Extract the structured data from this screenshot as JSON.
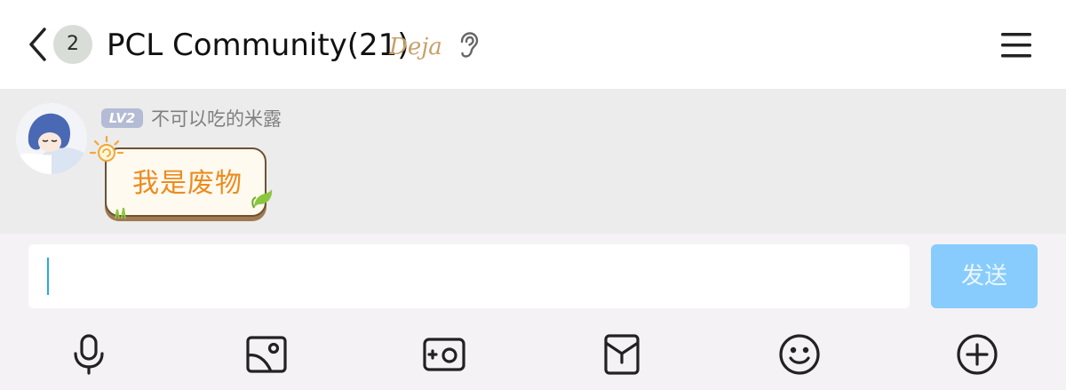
{
  "header": {
    "back_icon": "chevron-left-icon",
    "unread_count": "2",
    "title": "PCL Community(21)",
    "title_icon_text": "Deja",
    "ear_icon": "ear-icon",
    "menu_icon": "hamburger-menu-icon"
  },
  "message": {
    "level_badge": "LV2",
    "sender": "不可以吃的米露",
    "text": "我是废物"
  },
  "composer": {
    "input_value": "",
    "input_placeholder": "",
    "send_label": "发送"
  },
  "toolbar": {
    "icons": [
      "microphone-icon",
      "image-icon",
      "camera-icon",
      "red-envelope-icon",
      "emoji-icon",
      "plus-icon"
    ]
  },
  "colors": {
    "send_button": "#87ccfc",
    "bubble_text": "#ec8b1f",
    "level_badge": "#b4bbd5",
    "chat_background": "#ececec"
  }
}
